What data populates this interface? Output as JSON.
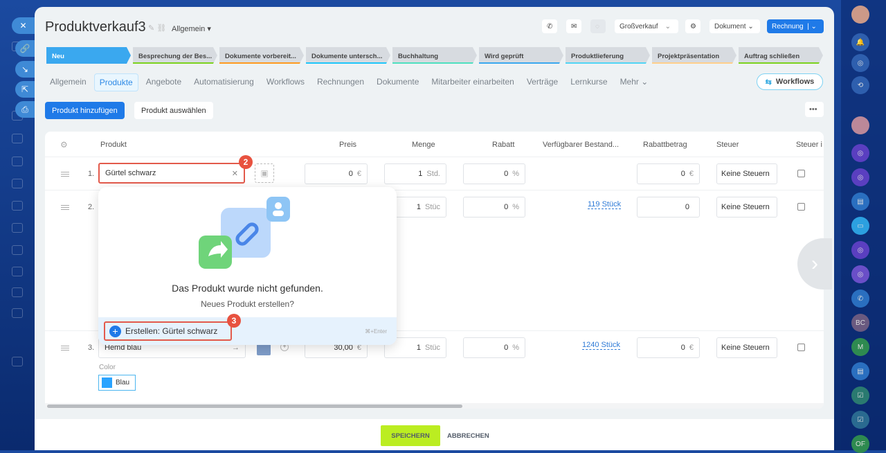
{
  "header": {
    "title": "Produktverkauf3",
    "category": "Allgemein",
    "pipeline": "Großverkauf",
    "document": "Dokument",
    "invoice": "Rechnung"
  },
  "stages": [
    {
      "label": "Neu",
      "color": "#3aa8ef"
    },
    {
      "label": "Besprechung der Bes...",
      "color": "#7cd21e"
    },
    {
      "label": "Dokumente vorbereit...",
      "color": "#ff9a1f"
    },
    {
      "label": "Dokumente untersch...",
      "color": "#1ec6fa"
    },
    {
      "label": "Buchhaltung",
      "color": "#4ee0c0"
    },
    {
      "label": "Wird geprüft",
      "color": "#3aa8ef"
    },
    {
      "label": "Produktlieferung",
      "color": "#50d5f5"
    },
    {
      "label": "Projektpräsentation",
      "color": "#ffcf8a"
    },
    {
      "label": "Auftrag schließen",
      "color": "#7cd21e"
    }
  ],
  "tabs": [
    "Allgemein",
    "Produkte",
    "Angebote",
    "Automatisierung",
    "Workflows",
    "Rechnungen",
    "Dokumente",
    "Mitarbeiter einarbeiten",
    "Verträge",
    "Lernkurse",
    "Mehr"
  ],
  "workflows_button": "Workflows",
  "actions": {
    "add": "Produkt hinzufügen",
    "select": "Produkt auswählen"
  },
  "table": {
    "headers": [
      "Produkt",
      "Preis",
      "Menge",
      "Rabatt",
      "Verfügbarer Bestand...",
      "Rabattbetrag",
      "Steuer",
      "Steuer i"
    ],
    "rows": [
      {
        "num": "1.",
        "product": "Gürtel schwarz",
        "price": "0",
        "currency": "€",
        "qty": "1",
        "unit": "Std.",
        "discount": "0",
        "pct": "%",
        "stock": "",
        "disc_amount": "0",
        "tax": "Keine Steuern"
      },
      {
        "num": "2.",
        "product": "",
        "price": "",
        "currency": "",
        "qty": "1",
        "unit": "Stüc",
        "discount": "0",
        "pct": "%",
        "stock": "119 Stück",
        "disc_amount": "0",
        "tax": "Keine Steuern"
      },
      {
        "num": "3.",
        "product": "Hemd blau",
        "price": "30,00",
        "currency": "€",
        "qty": "1",
        "unit": "Stüc",
        "discount": "0",
        "pct": "%",
        "stock": "1240 Stück",
        "disc_amount": "0",
        "tax": "Keine Steuern",
        "prop_label": "Color",
        "prop_value": "Blau"
      }
    ]
  },
  "popup": {
    "title": "Das Produkt wurde nicht gefunden.",
    "subtitle": "Neues Produkt erstellen?",
    "create": "Erstellen: Gürtel schwarz",
    "shortcut": "⌘+Enter"
  },
  "badges": [
    "2",
    "3"
  ],
  "footer": {
    "save": "SPEICHERN",
    "cancel": "ABBRECHEN"
  },
  "right_sidebar": {
    "initials": [
      "BC",
      "M",
      "OF"
    ]
  }
}
